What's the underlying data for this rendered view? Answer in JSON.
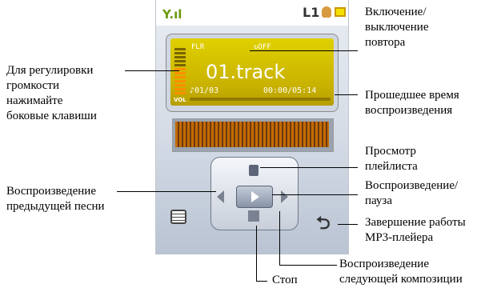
{
  "screen": {
    "lcd": {
      "format": "FLR",
      "repeat": "↻OFF",
      "track_name": "01.track",
      "track_number": "♪01/03",
      "time": "00:00/05:14",
      "volume_label": "VOL",
      "status_line": "L1"
    },
    "icons": [
      "signal-icon",
      "battery-icon",
      "playlist-icon",
      "previous-icon",
      "play-pause-icon",
      "next-icon",
      "stop-icon",
      "menu-list-icon",
      "back-icon"
    ]
  },
  "callouts": {
    "repeat_toggle": "Включение/\nвыключение\nповтора",
    "volume": "Для регулировки\nгромкости\nнажимайте\nбоковые клавиши",
    "elapsed_time": "Прошедшее время\nвоспроизведения",
    "playlist_view": "Просмотр\nплейлиста",
    "previous_song": "Воспроизведение\nпредыдущей песни",
    "play_pause": "Воспроизведение/\nпауза",
    "exit_player": "Завершение работы\nMP3-плейера",
    "next_track": "Воспроизведение\nследующей композиции",
    "stop": "Стоп"
  }
}
